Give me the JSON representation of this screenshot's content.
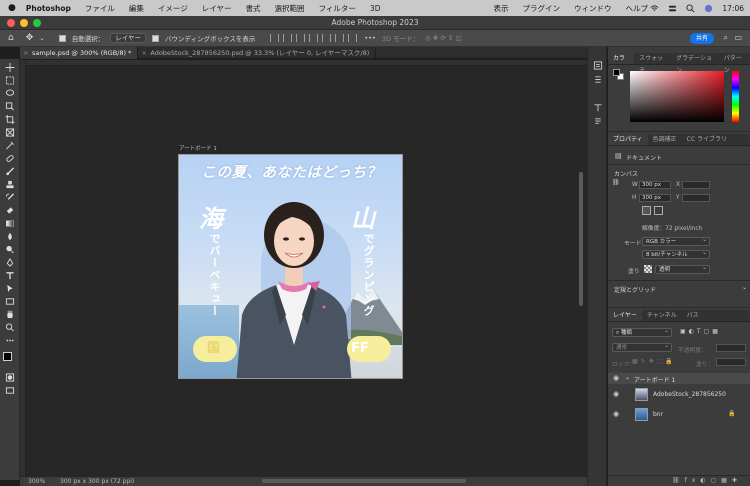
{
  "menubar": {
    "app": "Photoshop",
    "items": [
      "ファイル",
      "編集",
      "イメージ",
      "レイヤー",
      "書式",
      "選択範囲",
      "フィルター",
      "3D",
      "表示",
      "プラグイン",
      "ウィンドウ",
      "ヘルプ"
    ],
    "clock": "17:06"
  },
  "window": {
    "title": "Adobe Photoshop 2023"
  },
  "options": {
    "auto_select": "自動選択：",
    "layer_dd": "レイヤー",
    "bbox": "バウンディングボックスを表示",
    "mode3d": "3D モード：",
    "share": "共有"
  },
  "tabs": [
    {
      "label": "sample.psd @ 300% (RGB/8) *",
      "active": true
    },
    {
      "label": "AdobeStock_287856250.psd @ 33.3% (レイヤー 0, レイヤーマスク/8)",
      "active": false
    }
  ],
  "canvas": {
    "artboard_label": "アートボード 1",
    "banner": {
      "headline": "この夏、あなたはどっち？",
      "left_big": "海",
      "left_sub": "でバーベキュー",
      "right_big": "山",
      "right_sub": "でグランピング",
      "left_pill": "国",
      "right_pill": "FF"
    }
  },
  "status": {
    "zoom": "300%",
    "info": "300 px x 300 px (72 ppi)"
  },
  "color_panel": {
    "tabs": [
      "カラー",
      "スウォッチ",
      "グラデーション",
      "パターン"
    ]
  },
  "properties": {
    "tabs": [
      "プロパティ",
      "色調補正",
      "CC ライブラリ"
    ],
    "doc": "ドキュメント",
    "canvas_section": "カンバス",
    "w_label": "W",
    "w_value": "300 px",
    "h_label": "H",
    "h_value": "300 px",
    "x_label": "X",
    "y_label": "Y",
    "resolution": "解像度：72 pixel/inch",
    "mode_label": "モード",
    "mode_value": "RGB カラー",
    "bit_value": "8 bit/チャンネル",
    "fill_label": "塗り",
    "fill_value": "透明",
    "rulers_section": "定規とグリッド"
  },
  "layers_panel": {
    "tabs": [
      "レイヤー",
      "チャンネル",
      "パス"
    ],
    "kind": "種類",
    "blend": "通常",
    "opacity_label": "不透明度：",
    "lock_label": "ロック：",
    "fill_label": "塗り：",
    "layers": [
      {
        "name": "アートボード 1"
      },
      {
        "name": "AdobeStock_287856250"
      },
      {
        "name": "bnr"
      }
    ]
  },
  "colors": {
    "accent": "#1473e6",
    "pill": "#f6ee9d",
    "sky": "#b6d2f4"
  }
}
